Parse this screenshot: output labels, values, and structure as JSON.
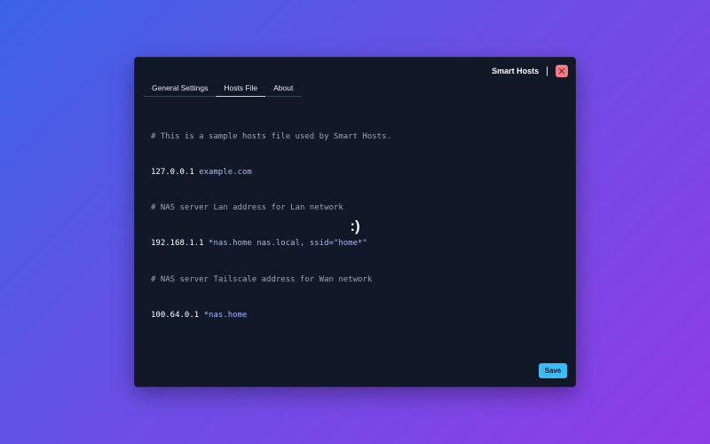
{
  "window": {
    "title": "Smart Hosts",
    "separator": "|"
  },
  "tabs": [
    {
      "label": "General Settings"
    },
    {
      "label": "Hosts File",
      "active": true
    },
    {
      "label": "About"
    }
  ],
  "editor": {
    "lines": [
      {
        "type": "comment",
        "text": "# This is a sample hosts file used by Smart Hosts."
      },
      {
        "type": "entry",
        "ip": "127.0.0.1",
        "hosts": "example.com"
      },
      {
        "type": "comment",
        "text": "# NAS server Lan address for Lan network"
      },
      {
        "type": "entry",
        "ip": "192.168.1.1",
        "hosts": "*nas.home nas.local, ssid=\"home*\""
      },
      {
        "type": "comment",
        "text": "# NAS server Tailscale address for Wan network"
      },
      {
        "type": "entry",
        "ip": "100.64.0.1",
        "hosts": "*nas.home"
      }
    ]
  },
  "center_glyph": ":)",
  "buttons": {
    "save_label": "Save",
    "close_icon": "close-icon"
  },
  "colors": {
    "window_bg": "#111827",
    "accent": "#38bdf8",
    "close": "#f47a84",
    "comment": "#9ca3af",
    "host": "#a5b4fc"
  }
}
